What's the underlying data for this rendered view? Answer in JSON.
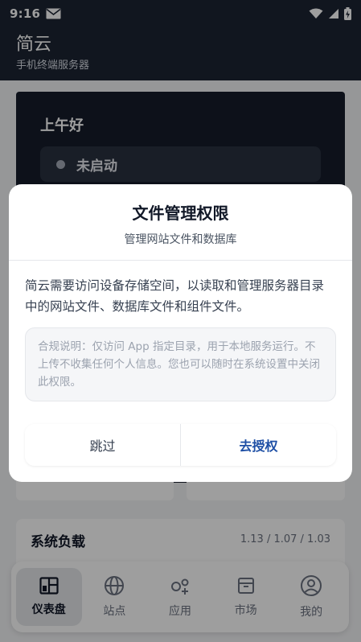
{
  "status_bar": {
    "time": "9:16"
  },
  "app_bar": {
    "title": "简云",
    "subtitle": "手机终端服务器"
  },
  "hero": {
    "greeting": "上午好",
    "server_status": "未启动"
  },
  "load_card": {
    "title": "系统负载",
    "values": "1.13 / 1.07 / 1.03"
  },
  "bottom_nav": {
    "items": [
      {
        "label": "仪表盘",
        "icon": "dashboard-icon",
        "active": true
      },
      {
        "label": "站点",
        "icon": "globe-icon",
        "active": false
      },
      {
        "label": "应用",
        "icon": "apps-icon",
        "active": false
      },
      {
        "label": "市场",
        "icon": "store-icon",
        "active": false
      },
      {
        "label": "我的",
        "icon": "profile-icon",
        "active": false
      }
    ]
  },
  "dialog": {
    "title": "文件管理权限",
    "subtitle": "管理网站文件和数据库",
    "body": "简云需要访问设备存储空间，以读取和管理服务器目录中的网站文件、数据库文件和组件文件。",
    "notice": "合规说明：仅访问 App 指定目录，用于本地服务运行。不上传不收集任何个人信息。您也可以随时在系统设置中关闭此权限。",
    "skip_label": "跳过",
    "grant_label": "去授权"
  },
  "colors": {
    "header_bg": "#1c2433",
    "hero_bg": "#151c2b",
    "accent": "#1e4fa5",
    "scrim": "rgba(0,0,0,0.38)"
  }
}
